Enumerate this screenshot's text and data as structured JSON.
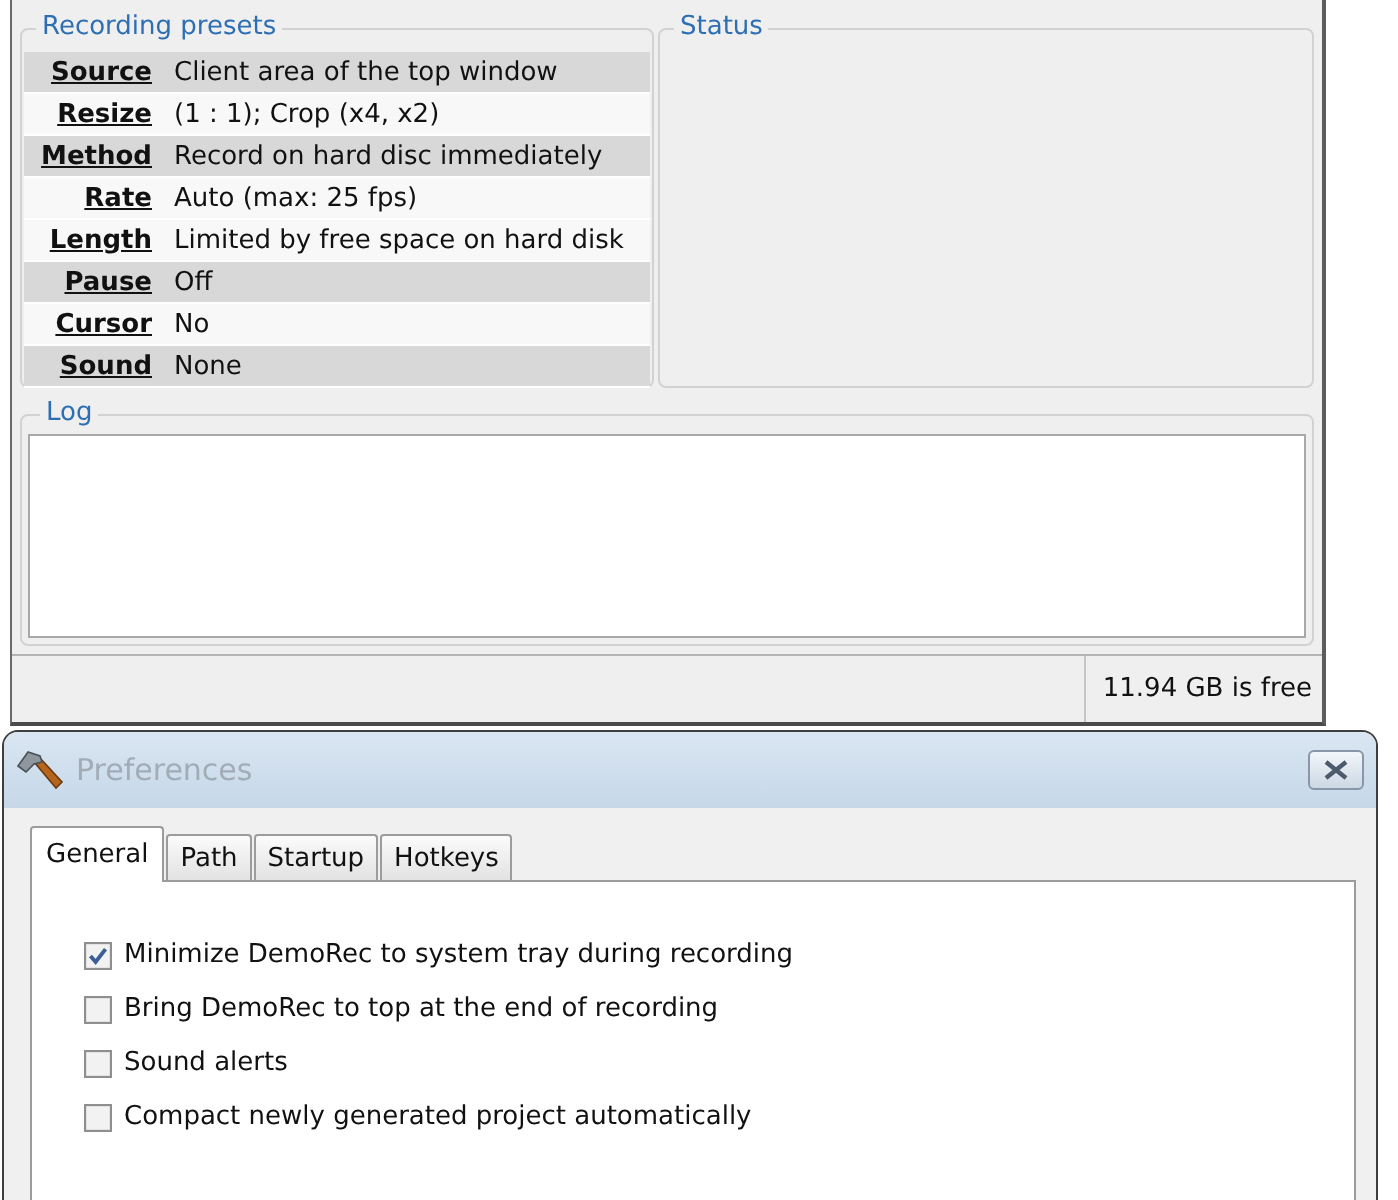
{
  "main_window": {
    "presets": {
      "title": "Recording presets",
      "rows": [
        {
          "label": "Source",
          "value": "Client area of the top window",
          "shaded": true
        },
        {
          "label": "Resize",
          "value": "(1 : 1); Crop (x4, x2)",
          "shaded": false
        },
        {
          "label": "Method",
          "value": "Record on hard disc immediately",
          "shaded": true
        },
        {
          "label": "Rate",
          "value": "Auto (max: 25 fps)",
          "shaded": false
        },
        {
          "label": "Length",
          "value": "Limited by free space on hard disk",
          "shaded": false
        },
        {
          "label": "Pause",
          "value": "Off",
          "shaded": true
        },
        {
          "label": "Cursor",
          "value": "No",
          "shaded": false
        },
        {
          "label": "Sound",
          "value": "None",
          "shaded": true
        }
      ]
    },
    "status": {
      "title": "Status"
    },
    "log": {
      "title": "Log"
    },
    "status_bar": {
      "free_space": "11.94 GB is free"
    }
  },
  "preferences": {
    "title": "Preferences",
    "tabs": [
      {
        "label": "General",
        "selected": true
      },
      {
        "label": "Path",
        "selected": false
      },
      {
        "label": "Startup",
        "selected": false
      },
      {
        "label": "Hotkeys",
        "selected": false
      }
    ],
    "options": [
      {
        "label": "Minimize DemoRec to system tray during recording",
        "checked": true
      },
      {
        "label": "Bring DemoRec to top at the end of recording",
        "checked": false
      },
      {
        "label": "Sound alerts",
        "checked": false
      },
      {
        "label": "Compact newly generated project automatically",
        "checked": false
      }
    ]
  }
}
